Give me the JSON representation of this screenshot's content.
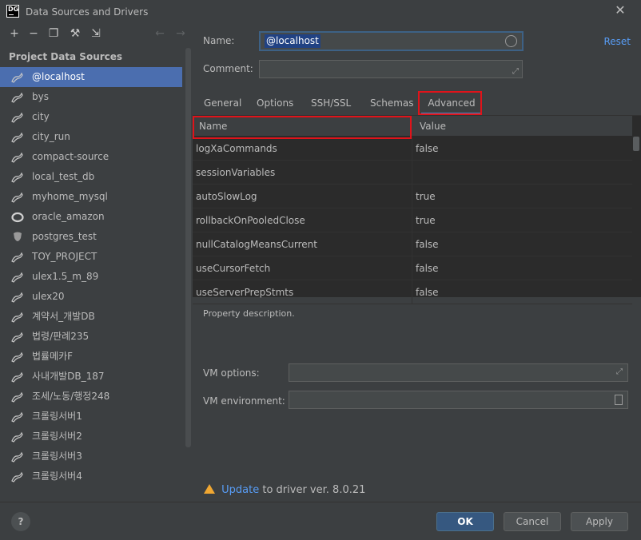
{
  "window": {
    "title": "Data Sources and Drivers",
    "logo": "DG"
  },
  "sidebar": {
    "header": "Project Data Sources",
    "toolbar_icons": [
      "add-icon",
      "remove-icon",
      "duplicate-icon",
      "wrench-icon",
      "import-icon",
      "back-arrow-icon",
      "forward-arrow-icon"
    ],
    "items": [
      {
        "label": "@localhost",
        "icon": "mysql-icon",
        "selected": true
      },
      {
        "label": "bys",
        "icon": "mysql-icon"
      },
      {
        "label": "city",
        "icon": "mysql-icon"
      },
      {
        "label": "city_run",
        "icon": "mysql-icon"
      },
      {
        "label": "compact-source",
        "icon": "mysql-icon"
      },
      {
        "label": "local_test_db",
        "icon": "mysql-icon"
      },
      {
        "label": "myhome_mysql",
        "icon": "mysql-icon"
      },
      {
        "label": "oracle_amazon",
        "icon": "oracle-icon"
      },
      {
        "label": "postgres_test",
        "icon": "postgres-icon"
      },
      {
        "label": "TOY_PROJECT",
        "icon": "mysql-icon"
      },
      {
        "label": "ulex1.5_m_89",
        "icon": "mysql-icon"
      },
      {
        "label": "ulex20",
        "icon": "mysql-icon"
      },
      {
        "label": "계약서_개발DB",
        "icon": "mysql-icon"
      },
      {
        "label": "법령/판례235",
        "icon": "mysql-icon"
      },
      {
        "label": "법률메카F",
        "icon": "mysql-icon"
      },
      {
        "label": "사내개발DB_187",
        "icon": "mysql-icon"
      },
      {
        "label": "조세/노동/행정248",
        "icon": "mysql-icon"
      },
      {
        "label": "크롤링서버1",
        "icon": "mysql-icon"
      },
      {
        "label": "크롤링서버2",
        "icon": "mysql-icon"
      },
      {
        "label": "크롤링서버3",
        "icon": "mysql-icon"
      },
      {
        "label": "크롤링서버4",
        "icon": "mysql-icon"
      }
    ]
  },
  "form": {
    "name_label": "Name:",
    "name_value": "@localhost",
    "reset_label": "Reset",
    "comment_label": "Comment:"
  },
  "tabs": [
    {
      "label": "General"
    },
    {
      "label": "Options"
    },
    {
      "label": "SSH/SSL"
    },
    {
      "label": "Schemas"
    },
    {
      "label": "Advanced",
      "active": true
    }
  ],
  "grid": {
    "headers": [
      "Name",
      "Value"
    ],
    "rows": [
      {
        "name": "logXaCommands",
        "value": "false"
      },
      {
        "name": "sessionVariables",
        "value": ""
      },
      {
        "name": "autoSlowLog",
        "value": "true"
      },
      {
        "name": "rollbackOnPooledClose",
        "value": "true"
      },
      {
        "name": "nullCatalogMeansCurrent",
        "value": "false"
      },
      {
        "name": "useCursorFetch",
        "value": "false"
      },
      {
        "name": "useServerPrepStmts",
        "value": "false"
      }
    ]
  },
  "description": "Property description.",
  "vm": {
    "options_label": "VM options:",
    "env_label": "VM environment:"
  },
  "update": {
    "link": "Update",
    "text": "to driver ver. 8.0.21"
  },
  "buttons": {
    "help": "?",
    "ok": "OK",
    "cancel": "Cancel",
    "apply": "Apply"
  },
  "colors": {
    "background": "#3c3f41",
    "selection": "#4b6eaf",
    "link": "#589df6",
    "highlight": "#e0131a",
    "warning": "#f0a732"
  }
}
